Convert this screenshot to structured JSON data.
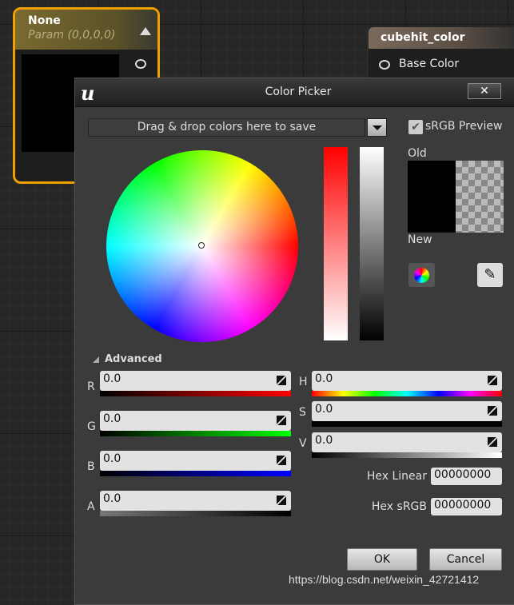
{
  "node_param": {
    "title": "None",
    "subtitle": "Param (0,0,0,0)"
  },
  "node_output": {
    "title": "cubehit_color",
    "pin_label": "Base Color"
  },
  "dialog": {
    "title": "Color Picker",
    "close_label": "✕",
    "saved_colors_placeholder": "Drag & drop colors here to save",
    "srgb_preview_label": "sRGB Preview",
    "srgb_preview_checked": true,
    "old_label": "Old",
    "new_label": "New",
    "advanced_label": "Advanced",
    "rgba": [
      {
        "label": "R",
        "value": "0.0"
      },
      {
        "label": "G",
        "value": "0.0"
      },
      {
        "label": "B",
        "value": "0.0"
      },
      {
        "label": "A",
        "value": "0.0"
      }
    ],
    "hsv": [
      {
        "label": "H",
        "value": "0.0"
      },
      {
        "label": "S",
        "value": "0.0"
      },
      {
        "label": "V",
        "value": "0.0"
      }
    ],
    "hex_linear_label": "Hex Linear",
    "hex_linear_value": "00000000",
    "hex_srgb_label": "Hex sRGB",
    "hex_srgb_value": "00000000",
    "ok_label": "OK",
    "cancel_label": "Cancel"
  },
  "watermark": "https://blog.csdn.net/weixin_42721412"
}
